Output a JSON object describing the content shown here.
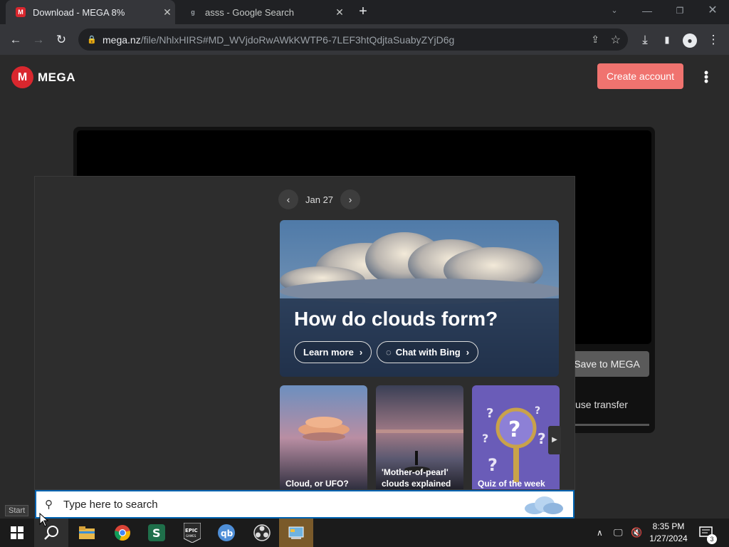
{
  "browser": {
    "tabs": [
      {
        "title": "Download - MEGA 8%",
        "favicon": "M",
        "active": true
      },
      {
        "title": "asss - Google Search",
        "favicon": "g",
        "active": false
      }
    ],
    "url_host": "mega.nz",
    "url_path": "/file/NhlxHIRS#MD_WVjdoRwAWkKWTP6-7LEF3htQdjtaSuabyZYjD6g"
  },
  "mega": {
    "brand": "MEGA",
    "create_account": "Create account",
    "save_to_mega": "Save to MEGA",
    "pause_transfer": "use transfer",
    "accent": "#d9272e"
  },
  "search_panel": {
    "date": "Jan 27",
    "hero_title": "How do clouds form?",
    "learn_more": "Learn more",
    "chat_with_bing": "Chat with Bing",
    "cards": [
      {
        "label": "Cloud, or UFO?"
      },
      {
        "label": "'Mother-of-pearl' clouds explained"
      },
      {
        "label": "Quiz of the week"
      }
    ],
    "search_placeholder": "Type here to search",
    "start_label": "Start"
  },
  "taskbar": {
    "apps": [
      "windows-start",
      "search",
      "file-explorer",
      "chrome",
      "app-green",
      "epic-games",
      "qbittorrent",
      "obs",
      "control-panel"
    ],
    "time": "8:35 PM",
    "date": "1/27/2024",
    "notification_count": "3"
  }
}
